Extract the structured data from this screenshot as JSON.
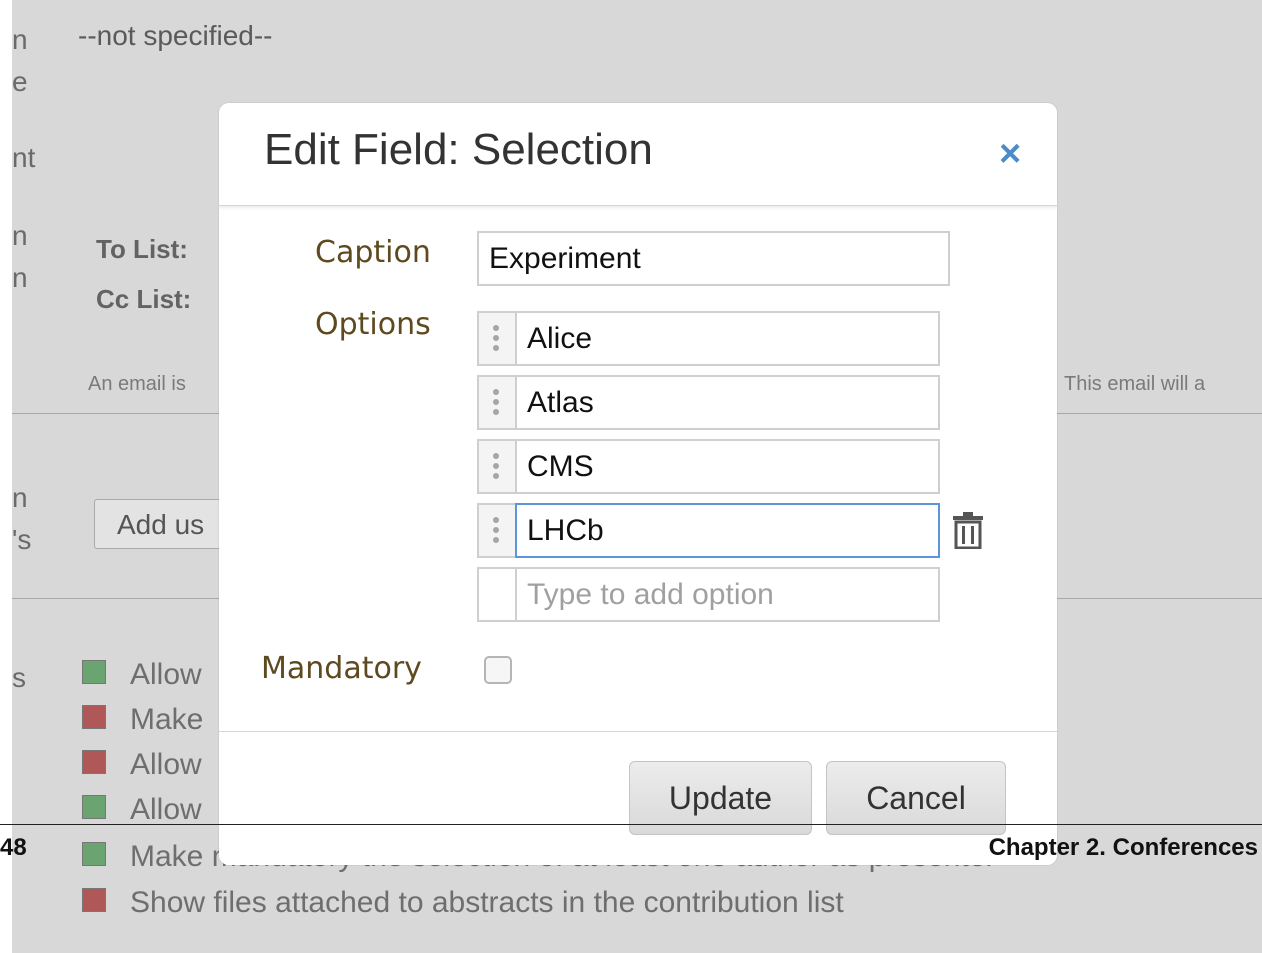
{
  "background": {
    "not_specified": "--not specified--",
    "left_letters": [
      "n",
      "e",
      "nt",
      "n",
      "n",
      "n",
      "'s",
      "s"
    ],
    "to_list": "To List:",
    "cc_list": "Cc List:",
    "email_note_left": "An email is",
    "email_note_right": "This email will a",
    "add_users_button": "Add us",
    "options": [
      {
        "label": "Allow",
        "status": "green"
      },
      {
        "label": "Make",
        "status": "red"
      },
      {
        "label": "Allow",
        "status": "red"
      },
      {
        "label": "Allow",
        "status": "green"
      },
      {
        "label": "Make mandatory the selection of at least one author as presenter",
        "status": "green"
      },
      {
        "label": "Show files attached to abstracts in the contribution list",
        "status": "red"
      }
    ]
  },
  "page_footer": {
    "page_number": "48",
    "chapter": "Chapter 2.  Conferences"
  },
  "modal": {
    "title": "Edit Field: Selection",
    "close_symbol": "×",
    "caption_label": "Caption",
    "caption_value": "Experiment",
    "options_label": "Options",
    "options": [
      "Alice",
      "Atlas",
      "CMS",
      "LHCb"
    ],
    "new_option_placeholder": "Type to add option",
    "mandatory_label": "Mandatory",
    "mandatory_checked": false,
    "update_button": "Update",
    "cancel_button": "Cancel"
  },
  "colors": {
    "accent": "#4a8cc9",
    "focus_border": "#5b95db",
    "label_brown": "#5e4a1e",
    "status_green": "#6aa470",
    "status_red": "#b05858"
  },
  "icons": {
    "close": "close-icon",
    "drag": "drag-handle-icon",
    "trash": "trash-icon"
  }
}
